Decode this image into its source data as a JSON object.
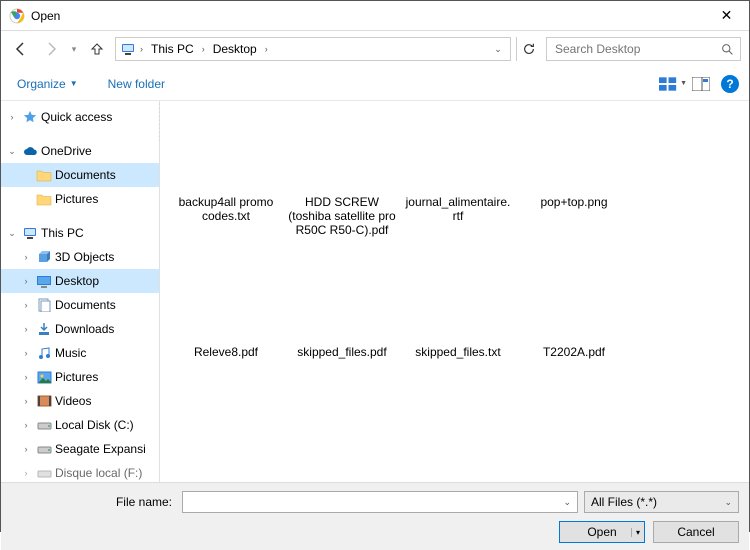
{
  "title": "Open",
  "breadcrumb": {
    "root_icon": "pc",
    "items": [
      "This PC",
      "Desktop"
    ]
  },
  "search": {
    "placeholder": "Search Desktop"
  },
  "commands": {
    "organize": "Organize",
    "newfolder": "New folder"
  },
  "tree": {
    "quick": "Quick access",
    "onedrive": "OneDrive",
    "od_docs": "Documents",
    "od_pics": "Pictures",
    "thispc": "This PC",
    "obj3d": "3D Objects",
    "desktop": "Desktop",
    "docs": "Documents",
    "downloads": "Downloads",
    "music": "Music",
    "pictures": "Pictures",
    "videos": "Videos",
    "localc": "Local Disk (C:)",
    "seagate": "Seagate Expansi",
    "last": "Disque local (F:)"
  },
  "files": [
    {
      "name": "backup4all promo codes.txt"
    },
    {
      "name": "HDD SCREW (toshiba satellite pro R50C R50-C).pdf"
    },
    {
      "name": "journal_alimentaire.rtf"
    },
    {
      "name": "pop+top.png"
    },
    {
      "name": "Releve8.pdf"
    },
    {
      "name": "skipped_files.pdf"
    },
    {
      "name": "skipped_files.txt"
    },
    {
      "name": "T2202A.pdf"
    }
  ],
  "footer": {
    "filename_label": "File name:",
    "filter": "All Files (*.*)",
    "open": "Open",
    "cancel": "Cancel"
  }
}
